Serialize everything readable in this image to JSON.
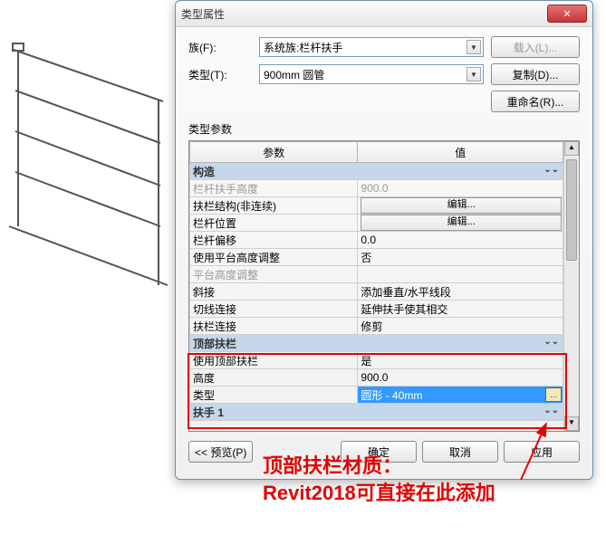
{
  "dialog": {
    "title": "类型属性",
    "family_label": "族(F):",
    "family_value": "系统族:栏杆扶手",
    "type_label": "类型(T):",
    "type_value": "900mm 圆管",
    "load_btn": "载入(L)...",
    "copy_btn": "复制(D)...",
    "rename_btn": "重命名(R)...",
    "type_params_label": "类型参数",
    "col_param": "参数",
    "col_value": "值",
    "sections": {
      "s1": "构造",
      "s2": "顶部扶栏",
      "s3": "扶手 1"
    },
    "rows": {
      "r1_p": "栏杆扶手高度",
      "r1_v": "900.0",
      "r2_p": "扶栏结构(非连续)",
      "r2_btn": "编辑...",
      "r3_p": "栏杆位置",
      "r3_btn": "编辑...",
      "r4_p": "栏杆偏移",
      "r4_v": "0.0",
      "r5_p": "使用平台高度调整",
      "r5_v": "否",
      "r6_p": "平台高度调整",
      "r7_p": "斜接",
      "r7_v": "添加垂直/水平线段",
      "r8_p": "切线连接",
      "r8_v": "延伸扶手使其相交",
      "r9_p": "扶栏连接",
      "r9_v": "修剪",
      "r10_p": "使用顶部扶栏",
      "r10_v": "是",
      "r11_p": "高度",
      "r11_v": "900.0",
      "r12_p": "类型",
      "r12_v": "圆形 - 40mm"
    },
    "browse_btn": "...",
    "preview_btn": "<< 预览(P)",
    "ok_btn": "确定",
    "cancel_btn": "取消",
    "apply_btn": "应用"
  },
  "annotation": {
    "line1": "顶部扶栏材质：",
    "line2": "Revit2018可直接在此添加"
  }
}
